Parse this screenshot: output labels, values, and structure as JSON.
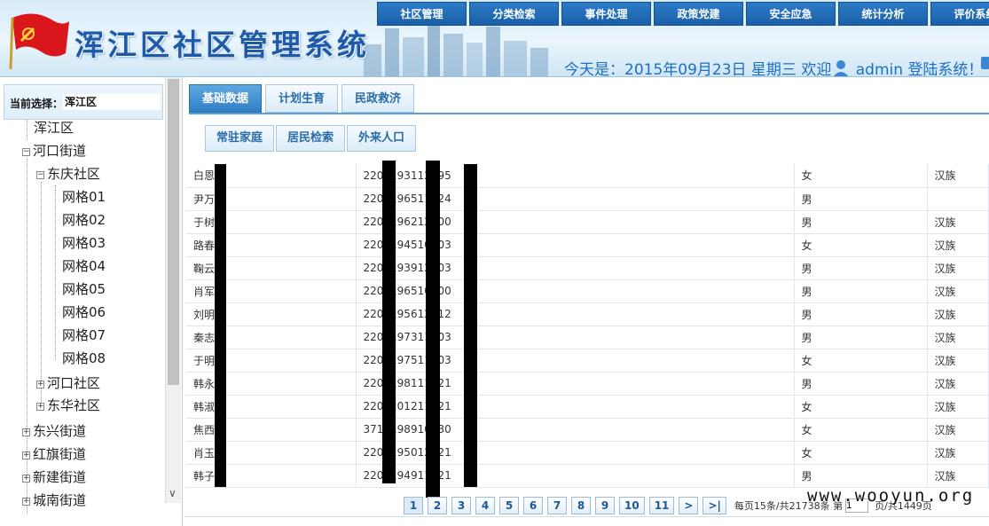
{
  "header": {
    "system_title": "浑江区社区管理系统",
    "welcome": "今天是：2015年09月23日 星期三 欢迎",
    "user": "admin",
    "login_suffix": "登陆系统！",
    "nav": [
      "社区管理",
      "分类检索",
      "事件处理",
      "政策党建",
      "安全应急",
      "统计分析",
      "评价系统"
    ]
  },
  "sidebar": {
    "current_label": "当前选择：",
    "current_value": "浑江区",
    "tree": {
      "root": "浑江区",
      "street1": "河口街道",
      "community1": "东庆社区",
      "grids": [
        "网格01",
        "网格02",
        "网格03",
        "网格04",
        "网格05",
        "网格06",
        "网格07",
        "网格08"
      ],
      "community2": "河口社区",
      "community3": "东华社区",
      "streets": [
        "东兴街道",
        "红旗街道",
        "新建街道",
        "城南街道"
      ]
    }
  },
  "main": {
    "tabs": [
      "基础数据",
      "计划生育",
      "民政救济"
    ],
    "subtabs": [
      "常驻家庭",
      "居民检索",
      "外来人口"
    ],
    "rows": [
      {
        "name": "白恩",
        "id": "2201193112095",
        "gender": "女",
        "nation": "汉族"
      },
      {
        "name": "尹万",
        "id": "2202196511524",
        "gender": "男",
        "nation": ""
      },
      {
        "name": "于树",
        "id": "2202196212900",
        "gender": "男",
        "nation": "汉族"
      },
      {
        "name": "路春",
        "id": "2203194510403",
        "gender": "女",
        "nation": "汉族"
      },
      {
        "name": "鞠云",
        "id": "2203193912903",
        "gender": "男",
        "nation": "汉族"
      },
      {
        "name": "肖军",
        "id": "2202196510400",
        "gender": "男",
        "nation": "汉族"
      },
      {
        "name": "刘明",
        "id": "2202195612712",
        "gender": "男",
        "nation": "汉族"
      },
      {
        "name": "秦志",
        "id": "2203197311803",
        "gender": "男",
        "nation": "汉族"
      },
      {
        "name": "于明",
        "id": "2202197511703",
        "gender": "女",
        "nation": "汉族"
      },
      {
        "name": "韩永",
        "id": "2202198111021",
        "gender": "男",
        "nation": "汉族"
      },
      {
        "name": "韩淑",
        "id": "2202201211321",
        "gender": "女",
        "nation": "汉族"
      },
      {
        "name": "焦西",
        "id": "3717198910130",
        "gender": "女",
        "nation": "汉族"
      },
      {
        "name": "肖玉",
        "id": "2202195012421",
        "gender": "女",
        "nation": "汉族"
      },
      {
        "name": "韩子",
        "id": "2202194911721",
        "gender": "男",
        "nation": "汉族"
      }
    ],
    "pager": {
      "pages": [
        "1",
        "2",
        "3",
        "4",
        "5",
        "6",
        "7",
        "8",
        "9",
        "10",
        "11",
        ">",
        ">|"
      ],
      "info": "每页15条/共21738条 第",
      "input": "1",
      "tail": "页/共1449页"
    }
  },
  "watermark": "www.wooyun.org"
}
